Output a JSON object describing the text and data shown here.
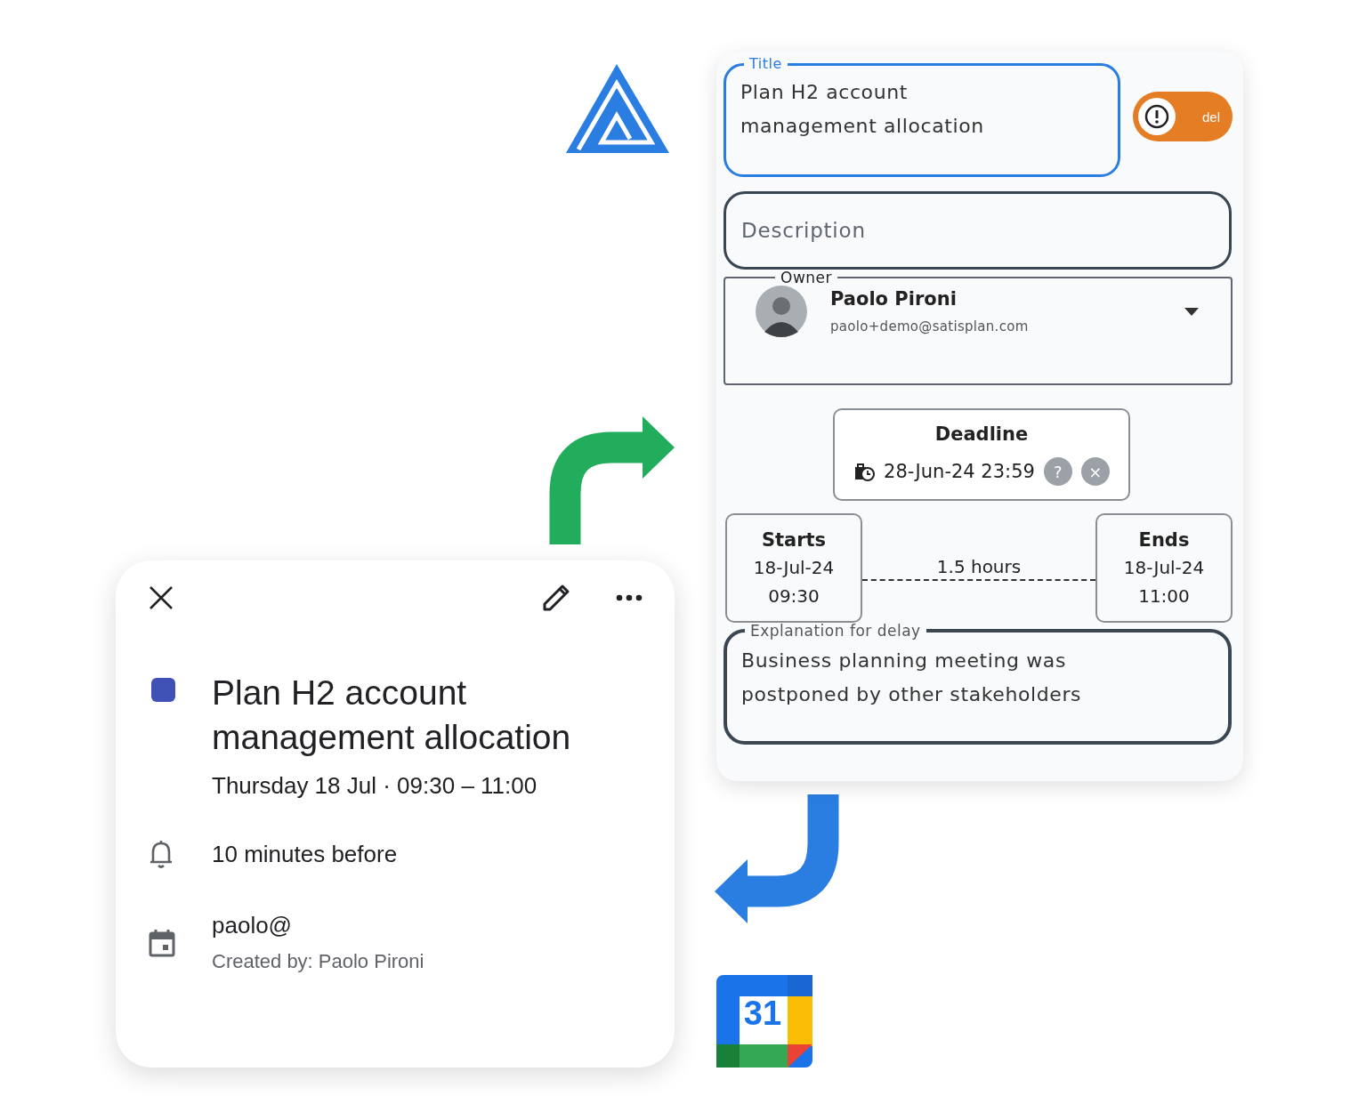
{
  "task_form": {
    "title_field": {
      "label": "Title",
      "value": "Plan H2 account management allocation"
    },
    "toggle": {
      "label": "del",
      "on": true
    },
    "description_field": {
      "placeholder": "Description"
    },
    "owner_field": {
      "label": "Owner",
      "name": "Paolo Pironi",
      "email": "paolo+demo@satisplan.com"
    },
    "deadline": {
      "label": "Deadline",
      "value": "28-Jun-24 23:59",
      "help": "?",
      "clear": "×"
    },
    "starts": {
      "label": "Starts",
      "date": "18-Jul-24",
      "time": "09:30"
    },
    "duration": "1.5 hours",
    "ends": {
      "label": "Ends",
      "date": "18-Jul-24",
      "time": "11:00"
    },
    "delay_field": {
      "label": "Explanation for delay",
      "value": "Business planning meeting was postponed by other stakeholders"
    }
  },
  "event_card": {
    "color": "#3f51b5",
    "title": "Plan H2 account management allocation",
    "when": "Thursday 18 Jul · 09:30 – 11:00",
    "reminder": "10 minutes before",
    "calendar": "paolo@",
    "created_by": "Created by: Paolo Pironi"
  },
  "calendar_logo": {
    "day": "31"
  }
}
